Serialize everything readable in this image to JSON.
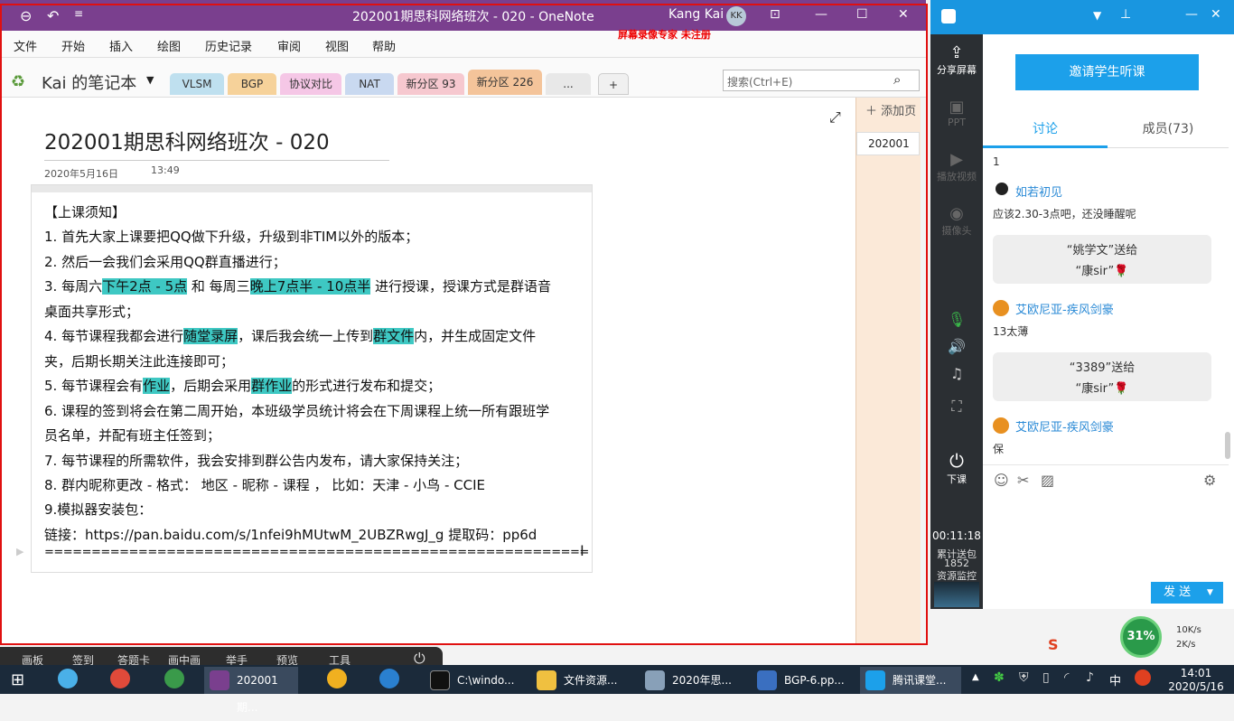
{
  "onenote": {
    "title": "202001期思科网络班次 - 020  -  OneNote",
    "user": "Kang Kai",
    "user_initials": "KK",
    "watermark": "屏幕录像专家  未注册",
    "menu": [
      "文件",
      "开始",
      "插入",
      "绘图",
      "历史记录",
      "审阅",
      "视图",
      "帮助"
    ],
    "notebook": "Kai 的笔记本",
    "tabs": [
      {
        "label": "VLSM",
        "color": "#bfe0ef"
      },
      {
        "label": "BGP",
        "color": "#f6d29a"
      },
      {
        "label": "协议对比",
        "color": "#f5c7e6"
      },
      {
        "label": "NAT",
        "color": "#c9d9f0"
      },
      {
        "label": "新分区 93",
        "color": "#f6c8cf"
      },
      {
        "label": "新分区 226",
        "color": "#f4c49a"
      },
      {
        "label": "...",
        "color": "#e8e8e8"
      },
      {
        "label": "+",
        "color": "#f0f0f0"
      }
    ],
    "search_placeholder": "搜索(Ctrl+E)",
    "add_page": "添加页",
    "page_list": [
      "202001"
    ],
    "page_title": "202001期思科网络班次 - 020",
    "page_date": "2020年5月16日",
    "page_time": "13:49",
    "lines": [
      "【上课须知】",
      "1. 首先大家上课要把QQ做下升级，升级到非TIM以外的版本；",
      "2. 然后一会我们会采用QQ群直播进行；",
      [
        "3. 每周六",
        "下午2点 - 5点",
        " 和 每周三",
        "晚上7点半 - 10点半",
        " 进行授课，授课方式是群语音"
      ],
      "桌面共享形式；",
      [
        "4. 每节课程我都会进行",
        "随堂录屏",
        "，课后我会统一上传到",
        "群文件",
        "内，并生成固定文件"
      ],
      "夹，后期长期关注此连接即可；",
      [
        "5. 每节课程会有",
        "作业",
        "，后期会采用",
        "群作业",
        "的形式进行发布和提交；"
      ],
      "6. 课程的签到将会在第二周开始，本班级学员统计将会在下周课程上统一所有跟班学",
      "员名单，并配有班主任签到；",
      "7. 每节课程的所需软件，我会安排到群公告内发布，请大家保持关注；",
      "8. 群内昵称更改 - 格式： 地区 - 昵称 - 课程 ， 比如：天津 - 小鸟 - CCIE",
      "9.模拟器安装包：",
      "链接：https://pan.baidu.com/s/1nfei9hMUtwM_2UBZRwgJ_g    提取码：pp6d",
      "=========================================================="
    ]
  },
  "toolstrip": [
    "画板",
    "签到",
    "答题卡",
    "画中画",
    "举手",
    "预览",
    "工具"
  ],
  "tencent": {
    "invite_button": "邀请学生听课",
    "tab_discuss": "讨论",
    "tab_members": "成员(73)",
    "side": [
      "分享屏幕",
      "PPT",
      "播放视频",
      "摄像头",
      "下课"
    ],
    "timer": "00:11:18",
    "gift_label": "累计送包",
    "gift_count": "1852",
    "monitor": "资源监控",
    "messages": [
      {
        "type": "text",
        "text": "1"
      },
      {
        "type": "user",
        "name": "如若初见"
      },
      {
        "type": "text",
        "text": "应该2.30-3点吧，还没睡醒呢"
      },
      {
        "type": "gift",
        "line1": "“姚学文”送给",
        "line2": "“康sir”🌹"
      },
      {
        "type": "user",
        "name": "艾欧尼亚-疾风剑豪"
      },
      {
        "type": "text",
        "text": "13太薄"
      },
      {
        "type": "gift",
        "line1": "“3389”送给",
        "line2": "“康sir”🌹"
      },
      {
        "type": "user",
        "name": "艾欧尼亚-疾风剑豪"
      },
      {
        "type": "text",
        "text": "保"
      }
    ],
    "send": "发 送",
    "net_percent": "31%",
    "net_up": "10K/s",
    "net_down": "2K/s"
  },
  "taskbar": {
    "items": [
      "202001期...",
      "C:\\windo...",
      "文件资源...",
      "2020年思...",
      "BGP-6.pp...",
      "腾讯课堂..."
    ],
    "time": "14:01",
    "date": "2020/5/16",
    "ime": "中"
  }
}
